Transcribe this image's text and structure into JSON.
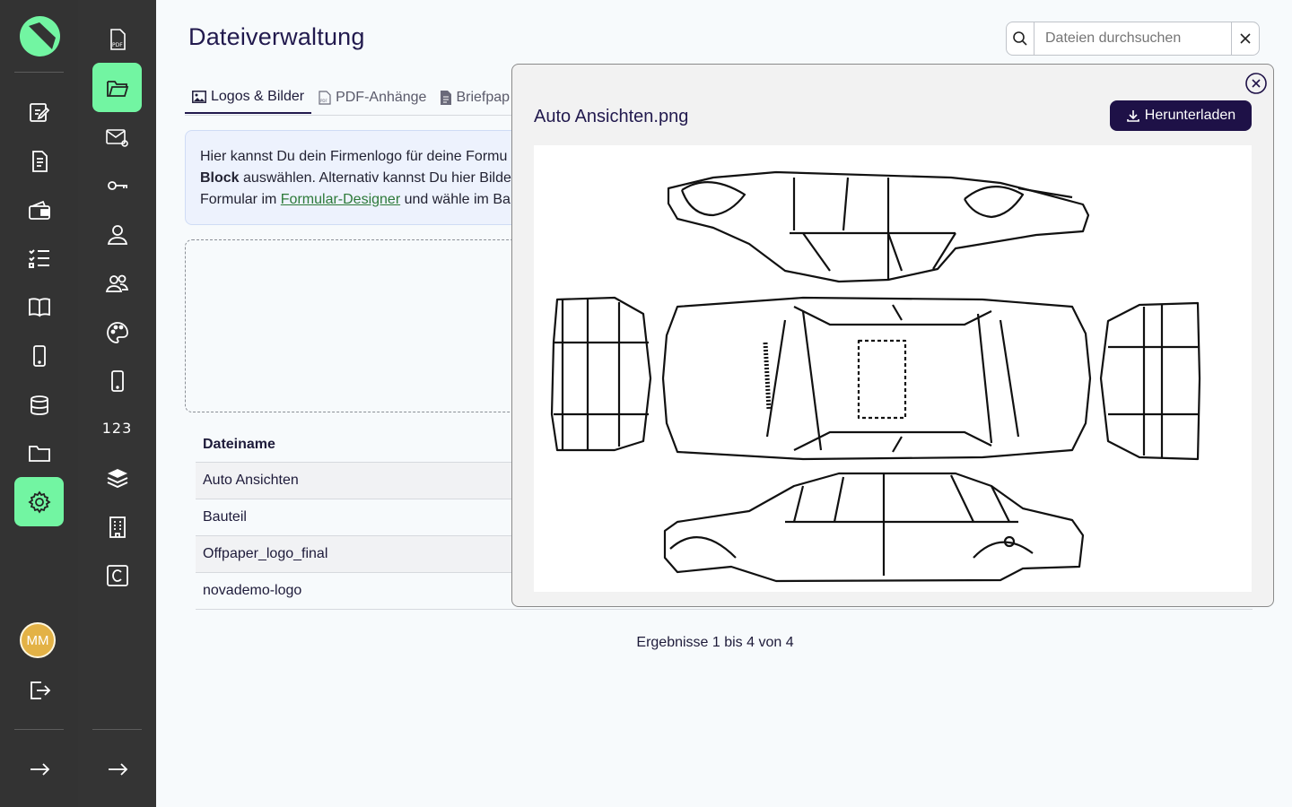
{
  "primary_nav": {
    "items": [
      {
        "icon": "edit-form-icon"
      },
      {
        "icon": "document-icon"
      },
      {
        "icon": "wallet-icon"
      },
      {
        "icon": "checklist-icon"
      },
      {
        "icon": "book-icon"
      },
      {
        "icon": "phone-icon"
      },
      {
        "icon": "database-icon"
      },
      {
        "icon": "folder-icon"
      },
      {
        "icon": "settings-icon",
        "active": true
      }
    ],
    "avatar_initials": "MM",
    "accent": "#72f5a2"
  },
  "secondary_nav": {
    "items": [
      {
        "icon": "pdf-file-icon"
      },
      {
        "icon": "folder-open-icon",
        "active": true
      },
      {
        "icon": "mail-at-icon"
      },
      {
        "icon": "key-icon"
      },
      {
        "icon": "user-icon"
      },
      {
        "icon": "users-icon"
      },
      {
        "icon": "palette-icon"
      },
      {
        "icon": "phone-icon"
      },
      {
        "icon": "numbers-icon",
        "label": "123"
      },
      {
        "icon": "layers-icon"
      },
      {
        "icon": "building-icon"
      },
      {
        "icon": "copyright-box-icon"
      }
    ]
  },
  "page": {
    "title": "Dateiverwaltung",
    "search_placeholder": "Dateien durchsuchen"
  },
  "tabs": [
    {
      "label": "Logos & Bilder",
      "icon": "image-icon",
      "active": true
    },
    {
      "label": "PDF-Anhänge",
      "icon": "pdf-icon"
    },
    {
      "label": "Briefpap",
      "icon": "file-icon"
    }
  ],
  "info": {
    "line1": "Hier kannst Du dein Firmenlogo für deine Formu",
    "line2_bold": "Block",
    "line2_rest": " auswählen. Alternativ kannst Du hier Bilde",
    "line3_pre": "Formular im ",
    "line3_link": "Formular-Designer",
    "line3_post": " und wähle im Ba"
  },
  "table": {
    "header": "Dateiname",
    "rows": [
      "Auto Ansichten",
      "Bauteil",
      "Offpaper_logo_final",
      "novademo-logo"
    ]
  },
  "results_text": "Ergebnisse 1 bis 4 von 4",
  "modal": {
    "title": "Auto Ansichten.png",
    "download_label": "Herunterladen"
  }
}
